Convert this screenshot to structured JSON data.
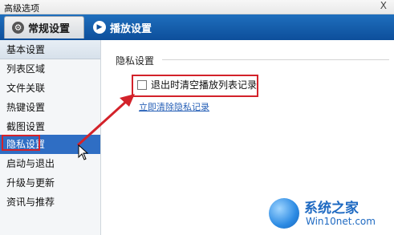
{
  "window": {
    "title": "高级选项",
    "close_glyph": "X"
  },
  "tabs": [
    {
      "label": "常规设置",
      "icon": "gear-icon",
      "active": true
    },
    {
      "label": "播放设置",
      "icon": "play-settings-icon",
      "active": false
    }
  ],
  "sidebar": {
    "items": [
      {
        "label": "基本设置"
      },
      {
        "label": "列表区域"
      },
      {
        "label": "文件关联"
      },
      {
        "label": "热键设置"
      },
      {
        "label": "截图设置"
      },
      {
        "label": "隐私设置"
      },
      {
        "label": "启动与退出"
      },
      {
        "label": "升级与更新"
      },
      {
        "label": "资讯与推荐"
      }
    ],
    "selected_index": 5
  },
  "privacy": {
    "section_title": "隐私设置",
    "checkbox_label": "退出时清空播放列表记录",
    "checkbox_checked": false,
    "clear_link": "立即清除隐私记录"
  },
  "annotation": {
    "color": "#d3222a"
  },
  "watermark": {
    "title": "系统之家",
    "url": "Win10net.com"
  },
  "colors": {
    "tab_band": "#1f6fbd",
    "selected": "#2f6ec4",
    "link": "#2760b7"
  }
}
